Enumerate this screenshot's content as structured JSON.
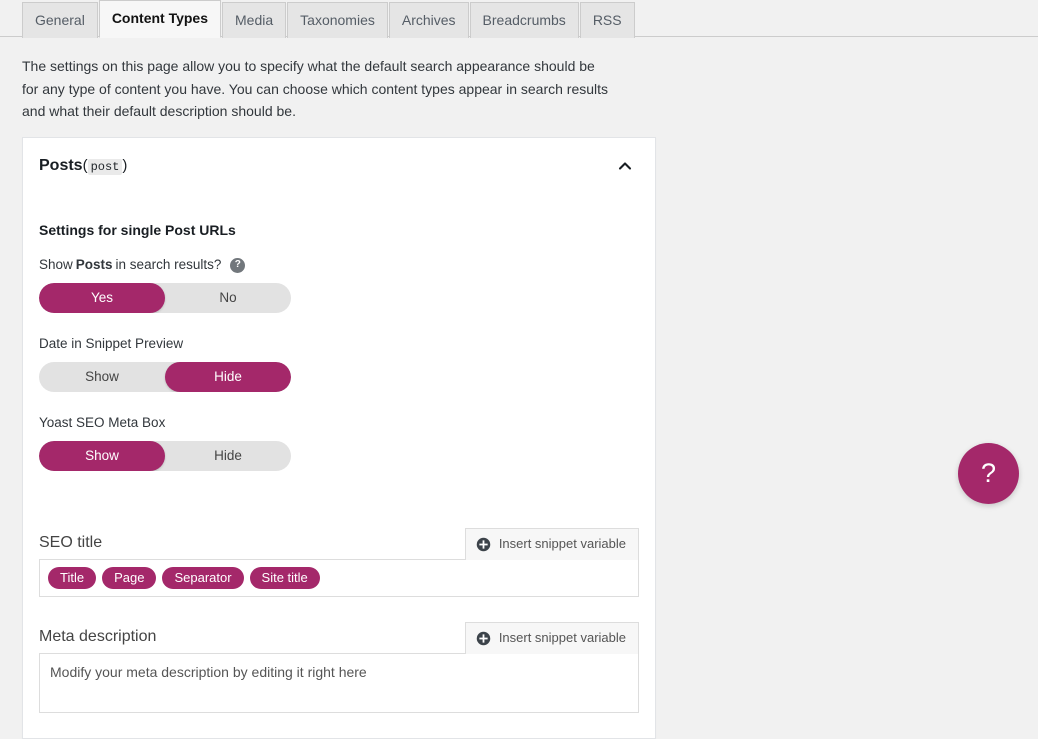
{
  "tabs": [
    {
      "label": "General",
      "active": false
    },
    {
      "label": "Content Types",
      "active": true
    },
    {
      "label": "Media",
      "active": false
    },
    {
      "label": "Taxonomies",
      "active": false
    },
    {
      "label": "Archives",
      "active": false
    },
    {
      "label": "Breadcrumbs",
      "active": false
    },
    {
      "label": "RSS",
      "active": false
    }
  ],
  "intro": {
    "text": "The settings on this page allow you to specify what the default search appearance should be for any type of content you have. You can choose which content types appear in search results and what their default description should be."
  },
  "card": {
    "title_main": "Posts",
    "title_paren_open": "(",
    "title_code": "post",
    "title_paren_close": ")",
    "collapse_icon": "chevron-up-icon",
    "section_title": "Settings for single Post URLs",
    "search_results": {
      "label_prefix": "Show",
      "label_strong": "Posts",
      "label_suffix": "in search results?",
      "help_icon": "question-mark-icon",
      "options": [
        "Yes",
        "No"
      ],
      "selected": "Yes"
    },
    "date_snippet": {
      "label": "Date in Snippet Preview",
      "options": [
        "Show",
        "Hide"
      ],
      "selected": "Hide"
    },
    "meta_box": {
      "label": "Yoast SEO Meta Box",
      "options": [
        "Show",
        "Hide"
      ],
      "selected": "Show"
    },
    "seo_title": {
      "label": "SEO title",
      "snippet_button": "Insert snippet variable",
      "snippet_icon": "plus-circle-icon",
      "tokens": [
        "Title",
        "Page",
        "Separator",
        "Site title"
      ]
    },
    "meta_description": {
      "label": "Meta description",
      "snippet_button": "Insert snippet variable",
      "snippet_icon": "plus-circle-icon",
      "value": "Modify your meta description by editing it right here"
    }
  },
  "help_fab": {
    "icon": "question-mark-icon",
    "glyph": "?"
  },
  "colors": {
    "accent": "#a4286a",
    "page_bg": "#f1f1f1",
    "card_bg": "#ffffff",
    "toggle_off_bg": "#e2e2e2"
  }
}
